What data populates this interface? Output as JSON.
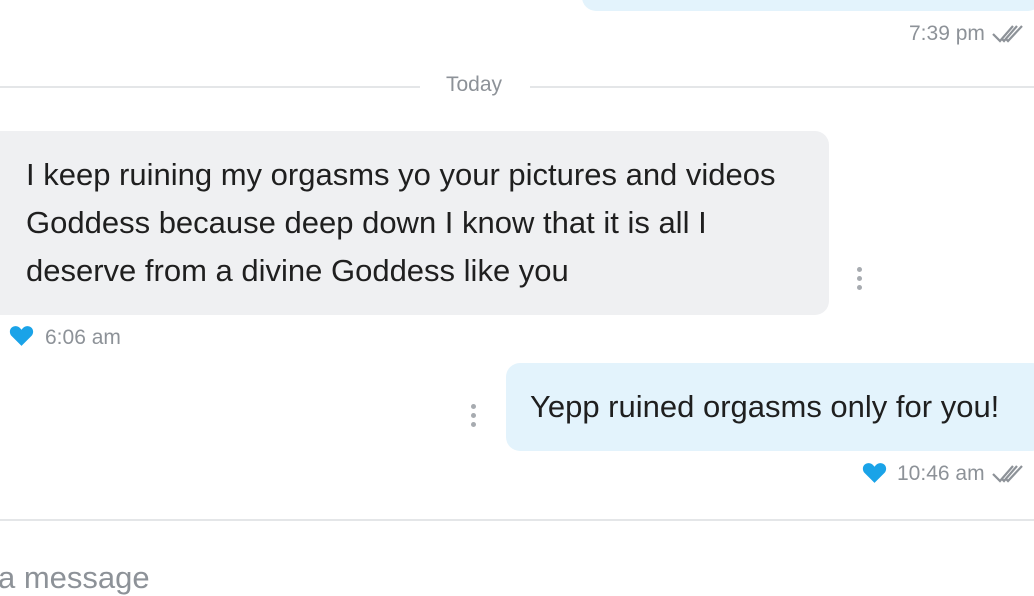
{
  "messages": [
    {
      "direction": "outgoing",
      "text": "",
      "time": "7:39 pm",
      "status_icon": "double-check-icon"
    },
    {
      "direction": "incoming",
      "text": "I keep ruining my orgasms yo your pictures and videos Goddess because deep down I know that it is all I deserve from a divine Goddess like you",
      "time": "6:06 am",
      "liked": true,
      "options_icon": "vertical-dots-icon"
    },
    {
      "direction": "outgoing",
      "text": "Yepp ruined orgasms only for you!",
      "time": "10:46 am",
      "liked": true,
      "status_icon": "double-check-icon",
      "options_icon": "vertical-dots-icon"
    }
  ],
  "divider": {
    "label": "Today"
  },
  "composer": {
    "placeholder": "a message"
  },
  "colors": {
    "incoming_bubble": "#eff0f2",
    "outgoing_bubble": "#e3f3fc",
    "heart": "#1aa3e8",
    "meta_text": "#8d9298"
  }
}
